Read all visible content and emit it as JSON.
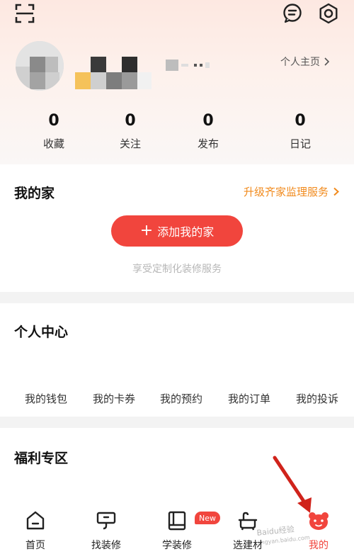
{
  "header": {
    "profile_link": "个人主页",
    "stats": [
      {
        "value": "0",
        "label": "收藏"
      },
      {
        "value": "0",
        "label": "关注"
      },
      {
        "value": "0",
        "label": "发布"
      },
      {
        "value": "0",
        "label": "日记"
      }
    ]
  },
  "my_home": {
    "title": "我的家",
    "upgrade_link": "升级齐家监理服务",
    "add_button": "添加我的家",
    "subtitle": "享受定制化装修服务"
  },
  "personal_center": {
    "title": "个人中心",
    "items": [
      "我的钱包",
      "我的卡券",
      "我的预约",
      "我的订单",
      "我的投诉"
    ]
  },
  "welfare": {
    "title": "福利专区"
  },
  "tabbar": {
    "tabs": [
      {
        "label": "首页",
        "icon": "home-icon"
      },
      {
        "label": "找装修",
        "icon": "find-decoration-icon"
      },
      {
        "label": "学装修",
        "icon": "learn-decoration-icon"
      },
      {
        "label": "选建材",
        "icon": "building-materials-icon"
      },
      {
        "label": "我的",
        "icon": "mine-icon"
      }
    ],
    "new_badge": "New",
    "active": "我的"
  },
  "watermark": {
    "line1": "Baidu经验",
    "line2": "jingyan.baidu.com"
  },
  "colors": {
    "accent": "#f1453d",
    "link_orange": "#f18a1c"
  }
}
